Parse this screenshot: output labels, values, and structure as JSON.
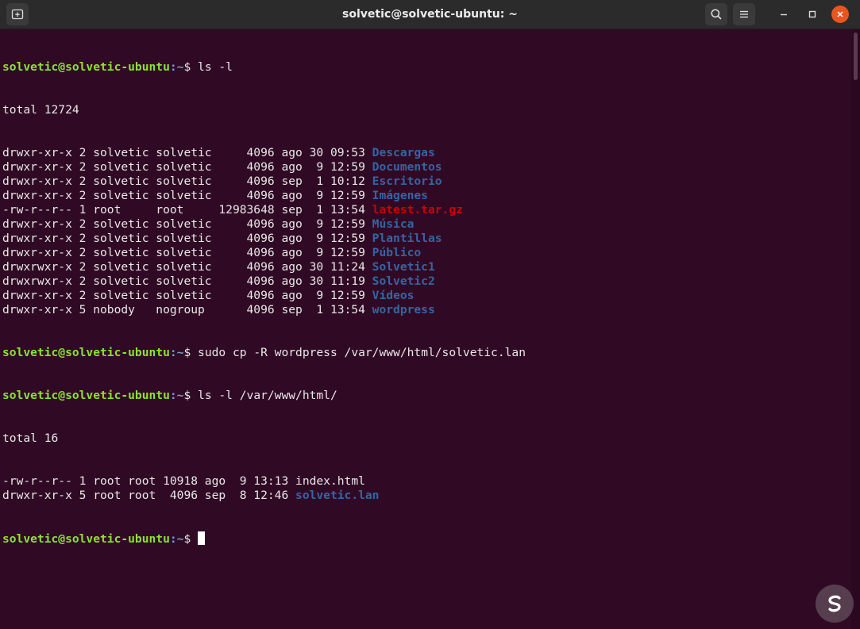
{
  "window": {
    "title": "solvetic@solvetic-ubuntu: ~",
    "icons": {
      "new_tab": "new-tab-icon",
      "search": "search-icon",
      "menu": "hamburger-menu-icon",
      "minimize": "minimize-icon",
      "maximize": "maximize-icon",
      "close": "close-icon"
    },
    "colors": {
      "background": "#300a24",
      "prompt_user": "#8ae234",
      "prompt_path": "#729fcf",
      "directory": "#3465a4",
      "archive": "#cc0000",
      "close_button": "#e9541f"
    }
  },
  "terminal": {
    "prompt": {
      "user_host": "solvetic@solvetic-ubuntu",
      "path": ":~",
      "symbol": "$ "
    },
    "commands": [
      "ls -l",
      "sudo cp -R wordpress /var/www/html/solvetic.lan",
      "ls -l /var/www/html/"
    ],
    "listing1": {
      "total": "total 12724",
      "rows": [
        {
          "meta": "drwxr-xr-x 2 solvetic solvetic     4096 ago 30 09:53 ",
          "name": "Descargas",
          "kind": "dir"
        },
        {
          "meta": "drwxr-xr-x 2 solvetic solvetic     4096 ago  9 12:59 ",
          "name": "Documentos",
          "kind": "dir"
        },
        {
          "meta": "drwxr-xr-x 2 solvetic solvetic     4096 sep  1 10:12 ",
          "name": "Escritorio",
          "kind": "dir"
        },
        {
          "meta": "drwxr-xr-x 2 solvetic solvetic     4096 ago  9 12:59 ",
          "name": "Imágenes",
          "kind": "dir"
        },
        {
          "meta": "-rw-r--r-- 1 root     root     12983648 sep  1 13:54 ",
          "name": "latest.tar.gz",
          "kind": "archive"
        },
        {
          "meta": "drwxr-xr-x 2 solvetic solvetic     4096 ago  9 12:59 ",
          "name": "Música",
          "kind": "dir"
        },
        {
          "meta": "drwxr-xr-x 2 solvetic solvetic     4096 ago  9 12:59 ",
          "name": "Plantillas",
          "kind": "dir"
        },
        {
          "meta": "drwxr-xr-x 2 solvetic solvetic     4096 ago  9 12:59 ",
          "name": "Público",
          "kind": "dir"
        },
        {
          "meta": "drwxrwxr-x 2 solvetic solvetic     4096 ago 30 11:24 ",
          "name": "Solvetic1",
          "kind": "dir"
        },
        {
          "meta": "drwxrwxr-x 2 solvetic solvetic     4096 ago 30 11:19 ",
          "name": "Solvetic2",
          "kind": "dir"
        },
        {
          "meta": "drwxr-xr-x 2 solvetic solvetic     4096 ago  9 12:59 ",
          "name": "Vídeos",
          "kind": "dir"
        },
        {
          "meta": "drwxr-xr-x 5 nobody   nogroup      4096 sep  1 13:54 ",
          "name": "wordpress",
          "kind": "dir"
        }
      ]
    },
    "listing2": {
      "total": "total 16",
      "rows": [
        {
          "meta": "-rw-r--r-- 1 root root 10918 ago  9 13:13 ",
          "name": "index.html",
          "kind": "file"
        },
        {
          "meta": "drwxr-xr-x 5 root root  4096 sep  8 12:46 ",
          "name": "solvetic.lan",
          "kind": "dir"
        }
      ]
    }
  }
}
